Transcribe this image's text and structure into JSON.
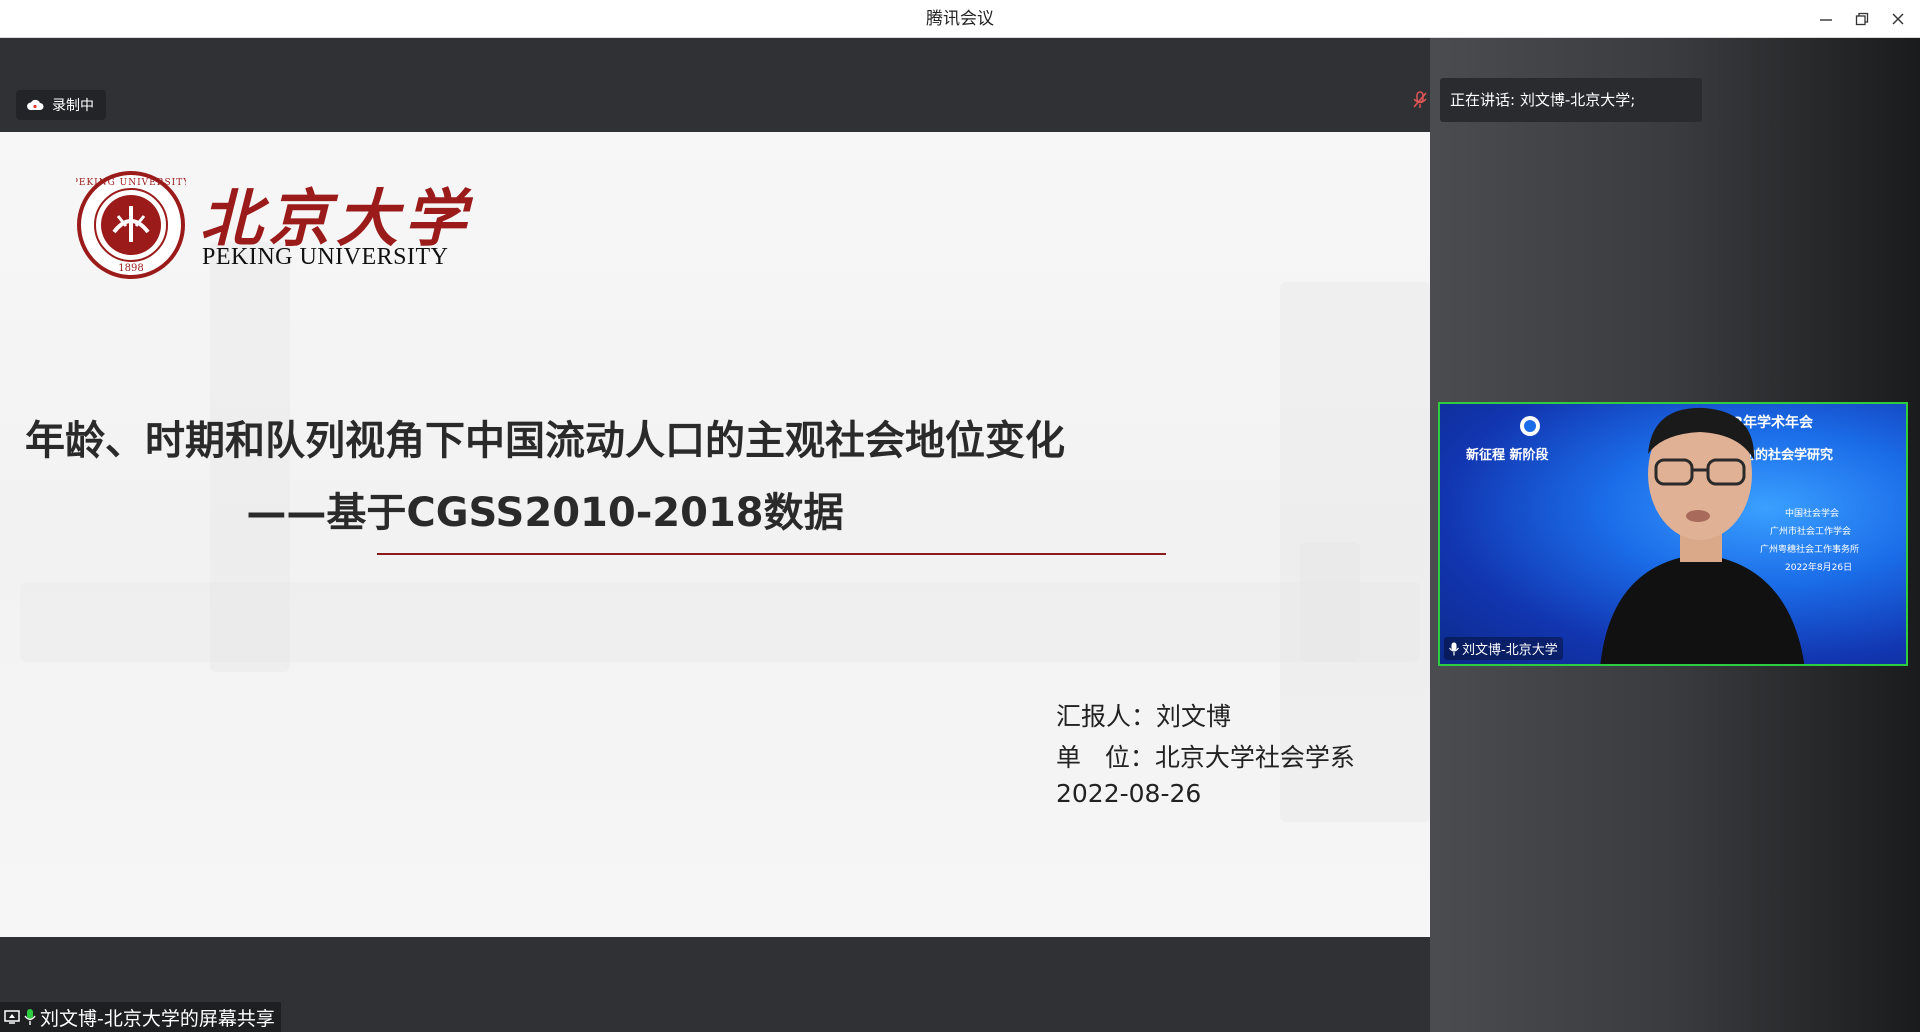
{
  "window": {
    "title": "腾讯会议"
  },
  "recording": {
    "label": "录制中"
  },
  "speaking": {
    "label": "正在讲话: 刘文博-北京大学;"
  },
  "slide": {
    "university_cn": "北京大学",
    "university_en": "PEKING UNIVERSITY",
    "seal_text": "PEKING UNIVERSITY",
    "seal_year": "1898",
    "title_line1": "年龄、时期和队列视角下中国流动人口的主观社会地位变化",
    "title_line2": "——基于CGSS2010-2018数据",
    "reporter": "汇报人：刘文博",
    "unit": "单   位：北京大学社会学系",
    "date": "2022-08-26"
  },
  "screen_share": {
    "label": "刘文博-北京大学的屏幕共享"
  },
  "video_tile": {
    "participant_name": "刘文博-北京大学",
    "banner_title": "学会2022年学术年会",
    "banner_left": "新征程 新阶段",
    "banner_right": "工城乡流动的社会学研究",
    "org1": "中国社会学会",
    "org2": "广州市社会工作学会",
    "org3": "广州粤穗社会工作事务所",
    "event_date": "2022年8月26日"
  },
  "colors": {
    "accent_red": "#8b1a1a",
    "active_border": "#2ecc40",
    "titlebar_bg": "#ffffff",
    "stage_bg": "#2f3134"
  }
}
